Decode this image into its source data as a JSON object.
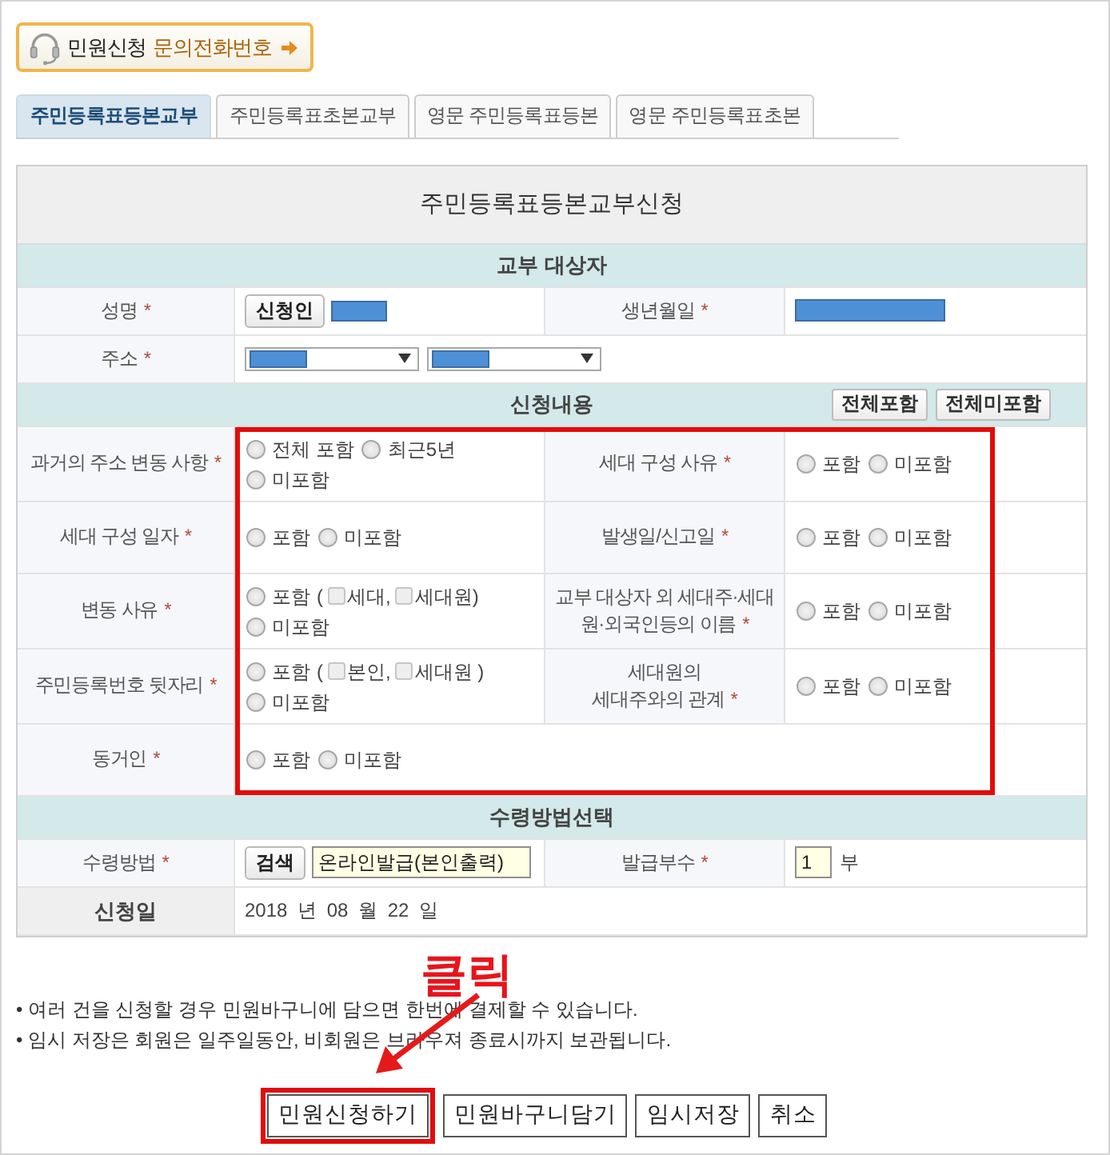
{
  "help_link": {
    "label": "민원신청",
    "accent": "문의전화번호"
  },
  "tabs": [
    {
      "label": "주민등록표등본교부",
      "selected": true
    },
    {
      "label": "주민등록표초본교부",
      "selected": false
    },
    {
      "label": "영문 주민등록표등본",
      "selected": false
    },
    {
      "label": "영문 주민등록표초본",
      "selected": false
    }
  ],
  "form": {
    "title": "주민등록표등본교부신청",
    "sections": [
      {
        "title": "교부 대상자",
        "highlighted": false,
        "rows": [
          {
            "cells": [
              {
                "kind": "label",
                "lines": [
                  "성명"
                ],
                "mark": "*"
              },
              {
                "kind": "applicant",
                "button": "신청인"
              },
              {
                "kind": "label",
                "lines": [
                  "생년월일"
                ],
                "mark": "*"
              },
              {
                "kind": "redacted"
              }
            ]
          },
          {
            "cells": [
              {
                "kind": "label",
                "lines": [
                  "주소"
                ],
                "mark": "*"
              },
              {
                "kind": "selects",
                "selects": [
                  {
                    "kind": "redacted"
                  },
                  {
                    "kind": "redacted"
                  }
                ]
              }
            ]
          }
        ]
      },
      {
        "title": "신청내용",
        "buttons": [
          "전체포함",
          "전체미포함"
        ],
        "highlighted": true,
        "rows": [
          {
            "cells": [
              {
                "kind": "label",
                "lines": [
                  "과거의 주소 변동 사항"
                ],
                "mark": "*"
              },
              {
                "kind": "radios",
                "options": [
                  {
                    "label": "전체 포함",
                    "selected": false
                  },
                  {
                    "label": "최근5년",
                    "selected": false
                  },
                  {
                    "label": "미포함",
                    "selected": false
                  }
                ]
              },
              {
                "kind": "label",
                "lines": [
                  "세대 구성 사유"
                ],
                "mark": "*"
              },
              {
                "kind": "radios",
                "options": [
                  {
                    "label": "포함",
                    "selected": false
                  },
                  {
                    "label": "미포함",
                    "selected": false
                  }
                ]
              }
            ]
          },
          {
            "cells": [
              {
                "kind": "label",
                "lines": [
                  "세대 구성 일자"
                ],
                "mark": "*"
              },
              {
                "kind": "radios",
                "options": [
                  {
                    "label": "포함",
                    "selected": false
                  },
                  {
                    "label": "미포함",
                    "selected": false
                  }
                ]
              },
              {
                "kind": "label",
                "lines": [
                  "발생일/신고일"
                ],
                "mark": "*"
              },
              {
                "kind": "radios",
                "options": [
                  {
                    "label": "포함",
                    "selected": false
                  },
                  {
                    "label": "미포함",
                    "selected": false
                  }
                ]
              }
            ]
          },
          {
            "cells": [
              {
                "kind": "label",
                "lines": [
                  "변동 사유"
                ],
                "mark": "*"
              },
              {
                "kind": "radios",
                "options": [
                  {
                    "label": "포함",
                    "selected": false,
                    "bracket": "(",
                    "checks": [
                      {
                        "label": "세대,",
                        "checked": false
                      },
                      {
                        "label": "세대원)",
                        "checked": false
                      }
                    ]
                  },
                  {
                    "label": "미포함",
                    "selected": false
                  }
                ]
              },
              {
                "kind": "label",
                "lines": [
                  "교부 대상자 외 세대주·세대",
                  "원·외국인등의 이름"
                ],
                "mark": "*"
              },
              {
                "kind": "radios",
                "options": [
                  {
                    "label": "포함",
                    "selected": false
                  },
                  {
                    "label": "미포함",
                    "selected": false
                  }
                ]
              }
            ]
          },
          {
            "cells": [
              {
                "kind": "label",
                "lines": [
                  "주민등록번호 뒷자리"
                ],
                "mark": "*"
              },
              {
                "kind": "radios",
                "options": [
                  {
                    "label": "포함",
                    "selected": false,
                    "bracket": "(",
                    "checks": [
                      {
                        "label": "본인,",
                        "checked": false
                      },
                      {
                        "label": "세대원 )",
                        "checked": false
                      }
                    ]
                  },
                  {
                    "label": "미포함",
                    "selected": false
                  }
                ]
              },
              {
                "kind": "label",
                "lines": [
                  "세대원의",
                  "세대주와의 관계"
                ],
                "mark": "*"
              },
              {
                "kind": "radios",
                "options": [
                  {
                    "label": "포함",
                    "selected": false
                  },
                  {
                    "label": "미포함",
                    "selected": false
                  }
                ]
              }
            ]
          },
          {
            "cells": [
              {
                "kind": "label",
                "lines": [
                  "동거인"
                ],
                "mark": "*"
              },
              {
                "kind": "radios",
                "options": [
                  {
                    "label": "포함",
                    "selected": false
                  },
                  {
                    "label": "미포함",
                    "selected": false
                  }
                ]
              }
            ]
          }
        ]
      },
      {
        "title": "수령방법선택",
        "highlighted": false,
        "rows": [
          {
            "cells": [
              {
                "kind": "label",
                "lines": [
                  "수령방법"
                ],
                "mark": "*"
              },
              {
                "kind": "search",
                "button": "검색",
                "value": "온라인발급(본인출력)"
              },
              {
                "kind": "label",
                "lines": [
                  "발급부수"
                ],
                "mark": "*"
              },
              {
                "kind": "count",
                "value": "1",
                "unit": "부"
              }
            ]
          },
          {
            "cells": [
              {
                "kind": "title_label",
                "lines": [
                  "신청일"
                ]
              },
              {
                "kind": "date",
                "text": "2018 년 08 월 22 일"
              }
            ]
          }
        ]
      }
    ]
  },
  "footer": {
    "callout": "클릭",
    "notes": [
      "• 여러 건을 신청할 경우 민원바구니에 담으면 한번에 결제할 수 있습니다.",
      "• 임시 저장은 회원은 일주일동안, 비회원은 브라우져 종료시까지 보관됩니다."
    ],
    "buttons": [
      {
        "label": "민원신청하기",
        "highlighted": true
      },
      {
        "label": "민원바구니담기",
        "highlighted": false
      },
      {
        "label": "임시저장",
        "highlighted": false
      },
      {
        "label": "취소",
        "highlighted": false
      }
    ]
  }
}
